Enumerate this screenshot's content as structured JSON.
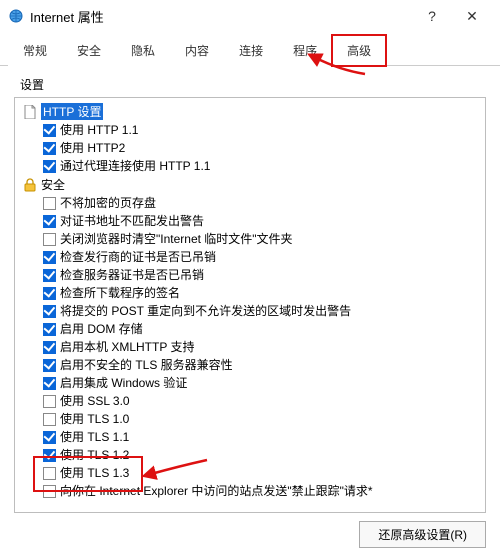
{
  "window": {
    "title": "Internet 属性",
    "help": "?",
    "close": "✕"
  },
  "tabs": {
    "items": [
      {
        "label": "常规"
      },
      {
        "label": "安全"
      },
      {
        "label": "隐私"
      },
      {
        "label": "内容"
      },
      {
        "label": "连接"
      },
      {
        "label": "程序"
      },
      {
        "label": "高级",
        "active": true,
        "highlight": true
      }
    ]
  },
  "settings_label": "设置",
  "tree": {
    "categories": [
      {
        "id": "http",
        "icon": "doc",
        "label": "HTTP 设置",
        "selected": true,
        "items": [
          {
            "label": "使用 HTTP 1.1",
            "checked": true
          },
          {
            "label": "使用 HTTP2",
            "checked": true
          },
          {
            "label": "通过代理连接使用 HTTP 1.1",
            "checked": true
          }
        ]
      },
      {
        "id": "security",
        "icon": "lock",
        "label": "安全",
        "selected": false,
        "items": [
          {
            "label": "不将加密的页存盘",
            "checked": false
          },
          {
            "label": "对证书地址不匹配发出警告",
            "checked": true
          },
          {
            "label": "关闭浏览器时清空\"Internet 临时文件\"文件夹",
            "checked": false
          },
          {
            "label": "检查发行商的证书是否已吊销",
            "checked": true
          },
          {
            "label": "检查服务器证书是否已吊销",
            "checked": true
          },
          {
            "label": "检查所下载程序的签名",
            "checked": true
          },
          {
            "label": "将提交的 POST 重定向到不允许发送的区域时发出警告",
            "checked": true
          },
          {
            "label": "启用 DOM 存储",
            "checked": true
          },
          {
            "label": "启用本机 XMLHTTP 支持",
            "checked": true
          },
          {
            "label": "启用不安全的 TLS 服务器兼容性",
            "checked": true
          },
          {
            "label": "启用集成 Windows 验证",
            "checked": true
          },
          {
            "label": "使用 SSL 3.0",
            "checked": false
          },
          {
            "label": "使用 TLS 1.0",
            "checked": false
          },
          {
            "label": "使用 TLS 1.1",
            "checked": true,
            "highlight": true
          },
          {
            "label": "使用 TLS 1.2",
            "checked": true,
            "highlight": true
          },
          {
            "label": "使用 TLS 1.3",
            "checked": false
          },
          {
            "label": "向你在 Internet Explorer 中访问的站点发送\"禁止跟踪\"请求*",
            "checked": false
          }
        ]
      }
    ]
  },
  "footer": {
    "restore_button": "还原高级设置(R)"
  }
}
